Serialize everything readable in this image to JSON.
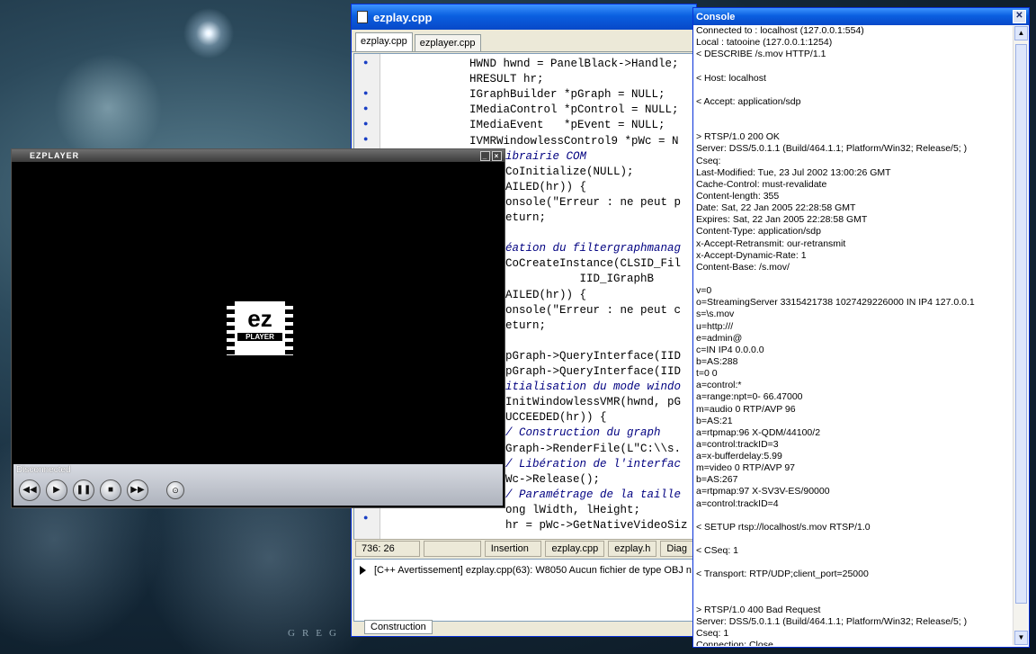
{
  "wallpaper": {
    "text": "GREG"
  },
  "editor": {
    "title": "ezplay.cpp",
    "tabs": [
      "ezplay.cpp",
      "ezplayer.cpp"
    ],
    "code": [
      "HWND hwnd = PanelBlack->Handle;",
      "HRESULT hr;",
      "IGraphBuilder *pGraph = NULL;",
      "IMediaControl *pControl = NULL;",
      "IMediaEvent   *pEvent = NULL;",
      "IVMRWindowlessControl9 *pWc = N",
      "ibrairie COM",
      "CoInitialize(NULL);",
      "AILED(hr)) {",
      "onsole(\"Erreur : ne peut p",
      "eturn;",
      "",
      "éation du filtergraphmanag",
      "CoCreateInstance(CLSID_Fil",
      "           IID_IGraphB",
      "AILED(hr)) {",
      "onsole(\"Erreur : ne peut c",
      "eturn;",
      "",
      "pGraph->QueryInterface(IID",
      "pGraph->QueryInterface(IID",
      "itialisation du mode windo",
      "InitWindowlessVMR(hwnd, pG",
      "UCCEEDED(hr)) {",
      "/ Construction du graph",
      "Graph->RenderFile(L\"C:\\\\s.",
      "/ Libération de l'interfac",
      "Wc->Release();",
      "/ Paramétrage de la taille",
      "ong lWidth, lHeight;",
      "hr = pWc->GetNativeVideoSiz"
    ],
    "status": {
      "position": "736:  26",
      "mode": "Insertion",
      "files": [
        "ezplay.cpp",
        "ezplay.h",
        "Diag"
      ]
    },
    "message": "[C++ Avertissement] ezplay.cpp(63): W8050 Aucun fichier de type OBJ n",
    "message_tab": "Construction"
  },
  "console": {
    "title": "Console",
    "close": "✕",
    "lines": [
      "Connected to : localhost (127.0.0.1:554)",
      "Local : tatooine (127.0.0.1:1254)",
      "< DESCRIBE /s.mov HTTP/1.1",
      "",
      "< Host: localhost",
      "",
      "< Accept: application/sdp",
      "",
      "",
      "> RTSP/1.0 200 OK",
      "Server: DSS/5.0.1.1 (Build/464.1.1; Platform/Win32; Release/5; )",
      "Cseq:",
      "Last-Modified: Tue, 23 Jul 2002 13:00:26 GMT",
      "Cache-Control: must-revalidate",
      "Content-length: 355",
      "Date: Sat, 22 Jan 2005 22:28:58 GMT",
      "Expires: Sat, 22 Jan 2005 22:28:58 GMT",
      "Content-Type: application/sdp",
      "x-Accept-Retransmit: our-retransmit",
      "x-Accept-Dynamic-Rate: 1",
      "Content-Base: /s.mov/",
      "",
      "v=0",
      "o=StreamingServer 3315421738 1027429226000 IN IP4 127.0.0.1",
      "s=\\s.mov",
      "u=http:///",
      "e=admin@",
      "c=IN IP4 0.0.0.0",
      "b=AS:288",
      "t=0 0",
      "a=control:*",
      "a=range:npt=0-  66.47000",
      "m=audio 0 RTP/AVP 96",
      "b=AS:21",
      "a=rtpmap:96 X-QDM/44100/2",
      "a=control:trackID=3",
      "a=x-bufferdelay:5.99",
      "m=video 0 RTP/AVP 97",
      "b=AS:267",
      "a=rtpmap:97 X-SV3V-ES/90000",
      "a=control:trackID=4",
      "",
      "< SETUP rtsp://localhost/s.mov RTSP/1.0",
      "",
      "< CSeq: 1",
      "",
      "< Transport: RTP/UDP;client_port=25000",
      "",
      "",
      "> RTSP/1.0 400 Bad Request",
      "Server: DSS/5.0.1.1 (Build/464.1.1; Platform/Win32; Release/5; )",
      "Cseq: 1",
      "Connection: Close"
    ]
  },
  "player": {
    "title": "EZPLAYER",
    "logo_top": "ez",
    "logo_bottom": "PLAYER",
    "status": "Disconnected",
    "buttons": [
      "◀◀",
      "▶",
      "❚❚",
      "■",
      "▶▶"
    ]
  }
}
